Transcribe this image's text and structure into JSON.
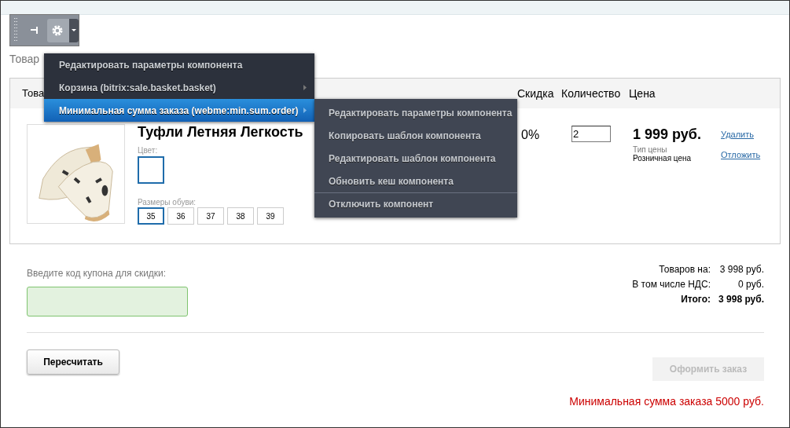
{
  "page_title": "Товар",
  "menu": {
    "items": [
      {
        "label": "Редактировать параметры компонента",
        "has_submenu": false,
        "selected": false
      },
      {
        "label": "Корзина (bitrix:sale.basket.basket)",
        "has_submenu": true,
        "selected": false
      },
      {
        "label": "Минимальная сумма заказа (webme:min.sum.order)",
        "has_submenu": true,
        "selected": true
      }
    ]
  },
  "submenu": {
    "items": [
      {
        "label": "Редактировать параметры компонента",
        "separator_before": false
      },
      {
        "label": "Копировать шаблон компонента",
        "separator_before": false
      },
      {
        "label": "Редактировать шаблон компонента",
        "separator_before": false
      },
      {
        "label": "Обновить кеш компонента",
        "separator_before": false
      },
      {
        "label": "Отключить компонент",
        "separator_before": true
      }
    ]
  },
  "table": {
    "columns": [
      "Това",
      "Скидка",
      "Количество",
      "Цена"
    ],
    "rows": [
      {
        "name": "Туфли Летняя Легкость",
        "color_label": "Цвет:",
        "size_label": "Размеры обуви:",
        "sizes": [
          {
            "label": "35",
            "selected": true
          },
          {
            "label": "36",
            "selected": false
          },
          {
            "label": "37",
            "selected": false
          },
          {
            "label": "38",
            "selected": false
          },
          {
            "label": "39",
            "selected": false
          }
        ],
        "discount": "0%",
        "quantity": "2",
        "price": "1 999 руб.",
        "price_type_label": "Тип цены",
        "price_type": "Розничная цена",
        "actions": [
          "Удалить",
          "Отложить"
        ]
      }
    ]
  },
  "coupon": {
    "label": "Введите код купона для скидки:"
  },
  "totals": [
    {
      "label": "Товаров на:",
      "value": "3 998 руб.",
      "bold": false
    },
    {
      "label": "В том числе НДС:",
      "value": "0 руб.",
      "bold": false
    },
    {
      "label": "Итого:",
      "value": "3 998 руб.",
      "bold": true
    }
  ],
  "recalc_button": {
    "label": "Пересчитать"
  },
  "order_button": {
    "label": "Оформить заказ",
    "disabled": true
  },
  "warning": "Минимальная сумма заказа 5000 руб."
}
